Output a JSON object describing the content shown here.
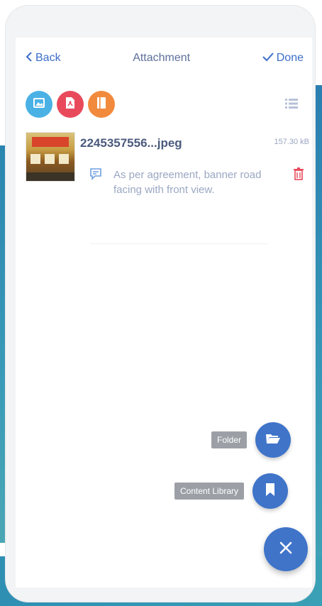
{
  "header": {
    "back_label": "Back",
    "title": "Attachment",
    "done_label": "Done"
  },
  "toolbar": {
    "icons": [
      "image-icon",
      "pdf-icon",
      "document-icon",
      "list-view-icon"
    ],
    "colors": {
      "image": "#4ab1e5",
      "pdf": "#e84a5c",
      "document": "#f28a3d"
    }
  },
  "attachment": {
    "file_name": "2245357556...jpeg",
    "file_size": "157.30 kB",
    "caption": "As per agreement, banner road facing with front view."
  },
  "fab_menu": {
    "folder_label": "Folder",
    "content_library_label": "Content Library"
  },
  "colors": {
    "accent": "#3f74c9",
    "delete": "#e84a5c"
  }
}
